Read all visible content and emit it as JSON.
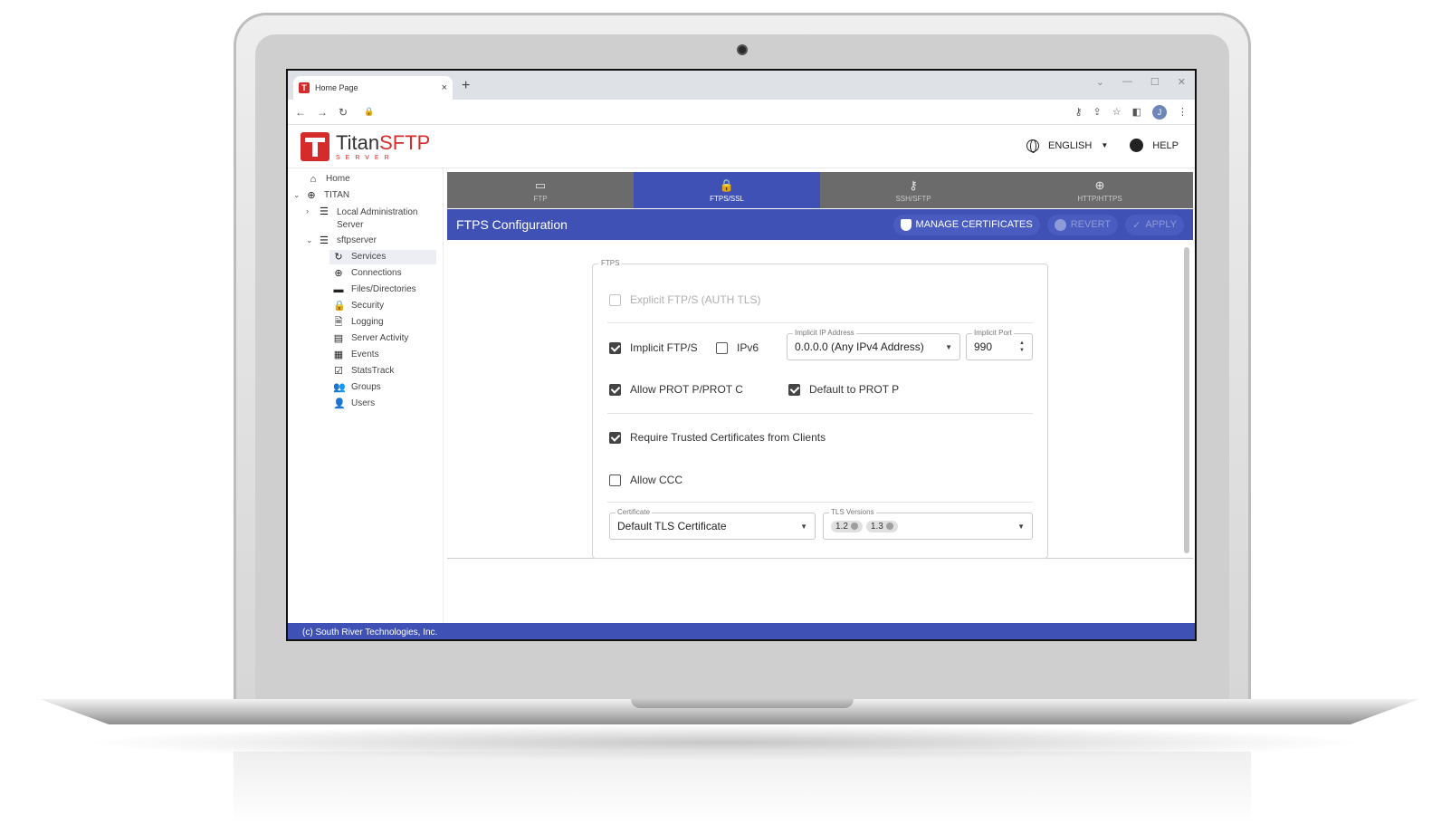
{
  "browser": {
    "tab_title": "Home Page",
    "tab_close": "×",
    "new_tab": "+"
  },
  "app": {
    "logo_titan": "Titan",
    "logo_sftp": "SFTP",
    "logo_sub": "SERVER",
    "language": "ENGLISH",
    "help": "HELP",
    "footer": "(c) South River Technologies, Inc."
  },
  "sidebar": {
    "home": "Home",
    "titan": "TITAN",
    "local_admin_line1": "Local Administration",
    "local_admin_line2": "Server",
    "sftpserver": "sftpserver",
    "services": "Services",
    "connections": "Connections",
    "files": "Files/Directories",
    "security": "Security",
    "logging": "Logging",
    "server_activity": "Server Activity",
    "events": "Events",
    "statstrack": "StatsTrack",
    "groups": "Groups",
    "users": "Users"
  },
  "service_tabs": {
    "ftp": "FTP",
    "ftps": "FTPS/SSL",
    "ssh": "SSH/SFTP",
    "http": "HTTP/HTTPS"
  },
  "config": {
    "title": "FTPS Configuration",
    "manage_certificates": "MANAGE CERTIFICATES",
    "revert": "REVERT",
    "apply": "APPLY"
  },
  "ftps": {
    "legend": "FTPS",
    "explicit": "Explicit FTP/S (AUTH TLS)",
    "implicit": "Implicit FTP/S",
    "ipv6": "IPv6",
    "implicit_ip_label": "Implicit IP Address",
    "implicit_ip_value": "0.0.0.0 (Any IPv4 Address)",
    "implicit_port_label": "Implicit Port",
    "implicit_port_value": "990",
    "allow_prot": "Allow PROT P/PROT C",
    "default_prot": "Default to PROT P",
    "require_trusted": "Require Trusted Certificates from Clients",
    "allow_ccc": "Allow CCC",
    "certificate_label": "Certificate",
    "certificate_value": "Default TLS Certificate",
    "tls_label": "TLS Versions",
    "tls_chip1": "1.2",
    "tls_chip2": "1.3"
  }
}
